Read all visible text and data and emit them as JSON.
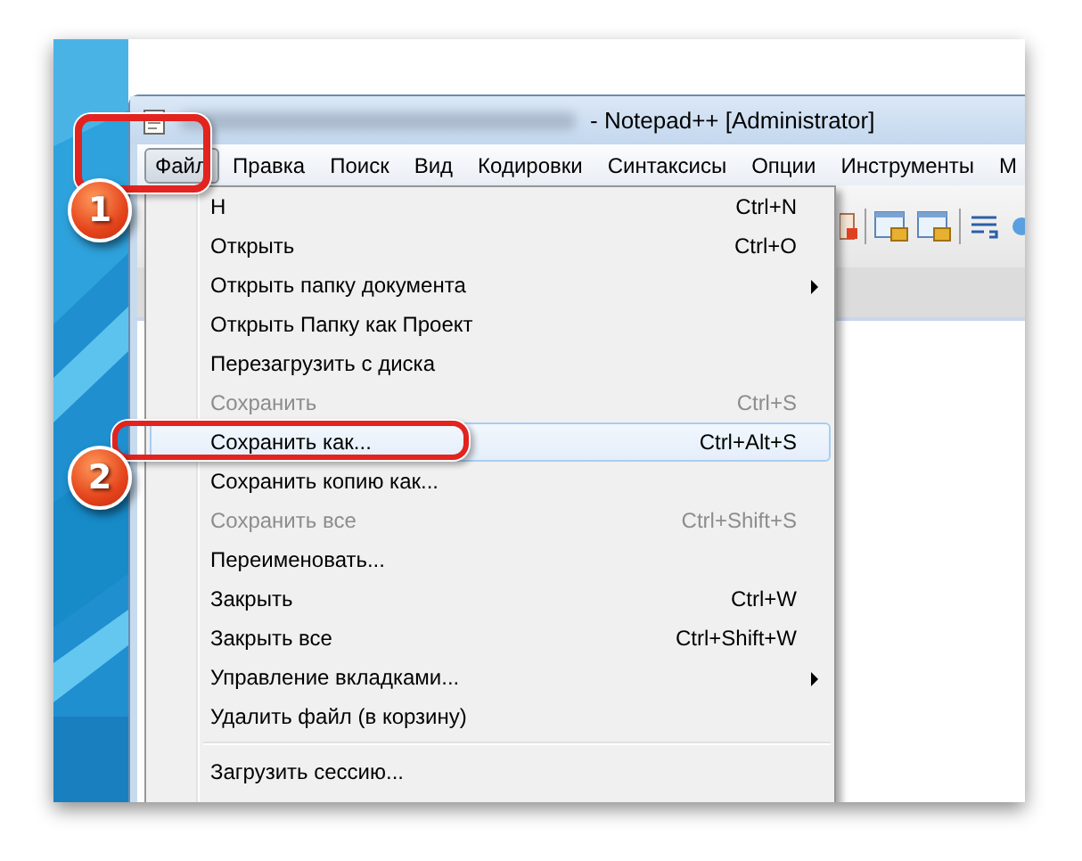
{
  "window": {
    "title": "- Notepad++ [Administrator]"
  },
  "menubar": [
    {
      "label": "Файл",
      "selected": true
    },
    {
      "label": "Правка",
      "selected": false
    },
    {
      "label": "Поиск",
      "selected": false
    },
    {
      "label": "Вид",
      "selected": false
    },
    {
      "label": "Кодировки",
      "selected": false
    },
    {
      "label": "Синтаксисы",
      "selected": false
    },
    {
      "label": "Опции",
      "selected": false
    },
    {
      "label": "Инструменты",
      "selected": false
    },
    {
      "label": "М",
      "selected": false
    }
  ],
  "file_menu": [
    {
      "kind": "item",
      "label": "Н",
      "shortcut": "Ctrl+N",
      "disabled": false,
      "selected": false,
      "submenu": false
    },
    {
      "kind": "item",
      "label": "Открыть",
      "shortcut": "Ctrl+O",
      "disabled": false,
      "selected": false,
      "submenu": false
    },
    {
      "kind": "item",
      "label": "Открыть папку документа",
      "disabled": false,
      "selected": false,
      "submenu": true
    },
    {
      "kind": "item",
      "label": "Открыть Папку как Проект",
      "disabled": false,
      "selected": false,
      "submenu": false
    },
    {
      "kind": "item",
      "label": "Перезагрузить с диска",
      "disabled": false,
      "selected": false,
      "submenu": false
    },
    {
      "kind": "item",
      "label": "Сохранить",
      "shortcut": "Ctrl+S",
      "disabled": true,
      "selected": false,
      "submenu": false
    },
    {
      "kind": "item",
      "label": "Сохранить как...",
      "shortcut": "Ctrl+Alt+S",
      "disabled": false,
      "selected": true,
      "submenu": false
    },
    {
      "kind": "item",
      "label": "Сохранить копию как...",
      "disabled": false,
      "selected": false,
      "submenu": false
    },
    {
      "kind": "item",
      "label": "Сохранить все",
      "shortcut": "Ctrl+Shift+S",
      "disabled": true,
      "selected": false,
      "submenu": false
    },
    {
      "kind": "item",
      "label": "Переименовать...",
      "disabled": false,
      "selected": false,
      "submenu": false
    },
    {
      "kind": "item",
      "label": "Закрыть",
      "shortcut": "Ctrl+W",
      "disabled": false,
      "selected": false,
      "submenu": false
    },
    {
      "kind": "item",
      "label": "Закрыть все",
      "shortcut": "Ctrl+Shift+W",
      "disabled": false,
      "selected": false,
      "submenu": false
    },
    {
      "kind": "item",
      "label": "Управление вкладками...",
      "disabled": false,
      "selected": false,
      "submenu": true
    },
    {
      "kind": "item",
      "label": "Удалить файл (в корзину)",
      "disabled": false,
      "selected": false,
      "submenu": false
    },
    {
      "kind": "separator"
    },
    {
      "kind": "item",
      "label": "Загрузить сессию...",
      "disabled": false,
      "selected": false,
      "submenu": false
    }
  ],
  "annotations": [
    {
      "number": "1"
    },
    {
      "number": "2"
    }
  ]
}
